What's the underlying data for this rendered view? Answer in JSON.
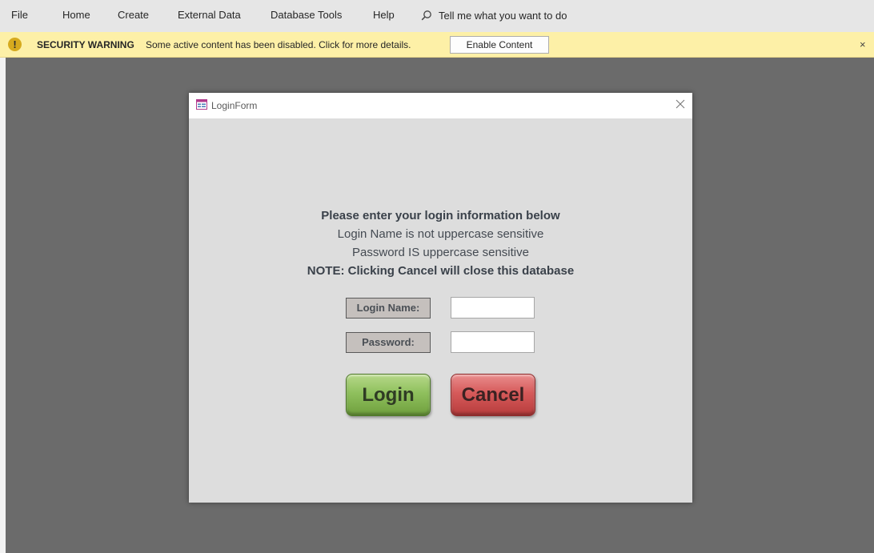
{
  "menu": {
    "items": [
      "File",
      "Home",
      "Create",
      "External Data",
      "Database Tools",
      "Help"
    ],
    "tell_me": "Tell me what you want to do"
  },
  "message_bar": {
    "title": "SECURITY WARNING",
    "text": "Some active content has been disabled. Click for more details.",
    "enable_button": "Enable Content",
    "close_glyph": "×"
  },
  "form": {
    "title": "LoginForm",
    "instructions": [
      "Please enter your login information below",
      "Login Name is not uppercase sensitive",
      "Password IS uppercase sensitive",
      "NOTE: Clicking Cancel will close this database"
    ],
    "login_name_label": "Login Name:",
    "login_name_value": "",
    "password_label": "Password:",
    "password_value": "",
    "login_button": "Login",
    "cancel_button": "Cancel"
  },
  "icons": {
    "search": "search-icon",
    "warning": "warning-icon",
    "form": "form-icon",
    "close": "close-icon"
  },
  "colors": {
    "workspace": "#6b6b6b",
    "ribbon": "#e6e6e6",
    "message_bar": "#fdf0a7",
    "form_background": "#dddddd",
    "login_green": "#8fc05d",
    "cancel_red": "#d65a5a"
  }
}
